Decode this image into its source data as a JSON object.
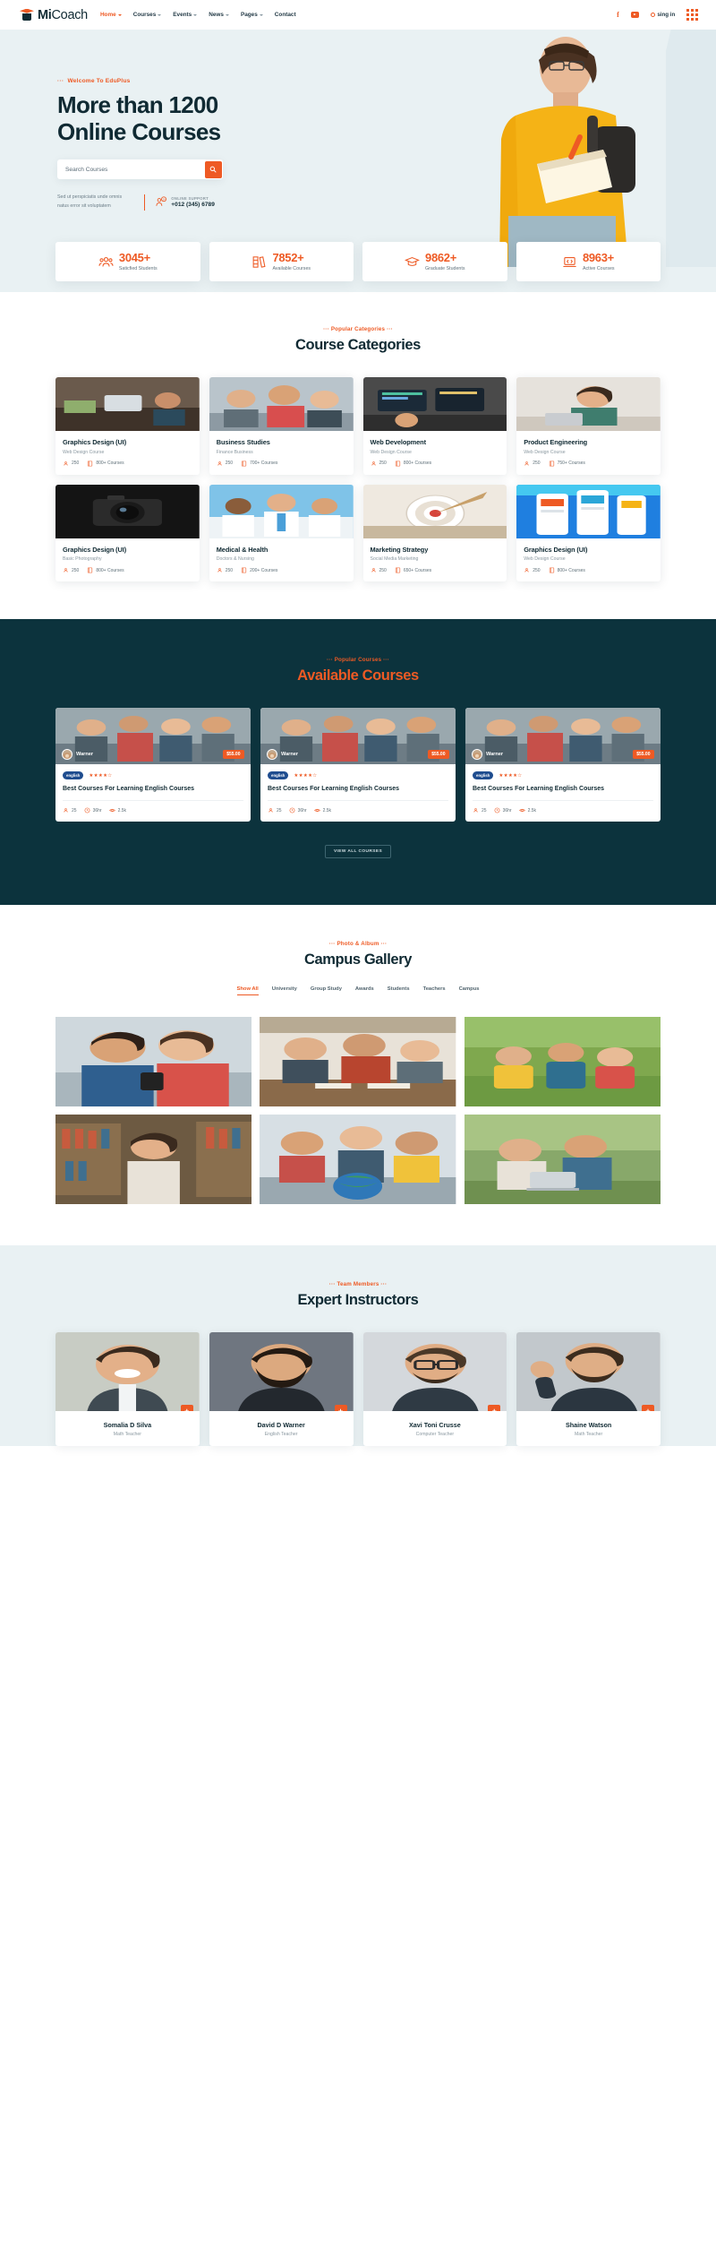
{
  "header": {
    "brand_first": "Mi",
    "brand_second": "Coach",
    "logo_icon": "graduation-cap-icon",
    "nav": [
      {
        "label": "Home",
        "has_caret": true,
        "active": true
      },
      {
        "label": "Courses",
        "has_caret": true,
        "active": false
      },
      {
        "label": "Events",
        "has_caret": true,
        "active": false
      },
      {
        "label": "News",
        "has_caret": true,
        "active": false
      },
      {
        "label": "Pages",
        "has_caret": true,
        "active": false
      },
      {
        "label": "Contact",
        "has_caret": false,
        "active": false
      }
    ],
    "facebook_icon": "facebook-icon",
    "youtube_icon": "youtube-icon",
    "signin_label": "sing in",
    "grid_icon": "grid-menu-icon"
  },
  "hero": {
    "eyebrow": "Welcome To EduPlus",
    "heading_line1": "More than 1200",
    "heading_line2": "Online Courses",
    "search_placeholder": "Search Courses",
    "search_value": "",
    "search_icon": "search-icon",
    "side_text": "Sed ut perspiciatis unde omnis natus error sit voluptatem",
    "support_icon": "headset-support-icon",
    "support_label": "ONLINE SUPPORT",
    "support_phone": "+012 (345) 6789"
  },
  "stats": [
    {
      "icon": "users-group-icon",
      "value": "3045+",
      "label": "Saticfied Students"
    },
    {
      "icon": "books-icon",
      "value": "7852+",
      "label": "Available Courses"
    },
    {
      "icon": "graduation-cap-icon",
      "value": "9862+",
      "label": "Graduate Students"
    },
    {
      "icon": "laptop-code-icon",
      "value": "8963+",
      "label": "Active Courses"
    }
  ],
  "categories": {
    "eyebrow": "Popular Categories",
    "title": "Course Categories",
    "items": [
      {
        "title": "Graphics Design (UI)",
        "sub": "Web Design Course",
        "students": "250",
        "courses": "800+ Courses",
        "thumb": "office-desk-photo"
      },
      {
        "title": "Business Studies",
        "sub": "Finance Business",
        "students": "250",
        "courses": "700+ Courses",
        "thumb": "team-meeting-photo"
      },
      {
        "title": "Web Development",
        "sub": "Web Design Course",
        "students": "250",
        "courses": "800+ Courses",
        "thumb": "developer-desk-photo"
      },
      {
        "title": "Product Engineering",
        "sub": "Web Design Course",
        "students": "250",
        "courses": "750+ Courses",
        "thumb": "woman-laptop-photo"
      },
      {
        "title": "Graphics Design (UI)",
        "sub": "Basic Photography",
        "students": "250",
        "courses": "800+ Courses",
        "thumb": "camera-photo"
      },
      {
        "title": "Medical & Health",
        "sub": "Doctors & Nursing",
        "students": "250",
        "courses": "200+ Courses",
        "thumb": "doctors-photo"
      },
      {
        "title": "Marketing Strategy",
        "sub": "Social Media Marketing",
        "students": "250",
        "courses": "650+ Courses",
        "thumb": "dartboard-photo"
      },
      {
        "title": "Graphics Design (UI)",
        "sub": "Web Design Course",
        "students": "250",
        "courses": "800+ Courses",
        "thumb": "mobile-ui-photo"
      }
    ]
  },
  "available": {
    "eyebrow": "Popular Courses",
    "title": "Available Courses",
    "view_all": "VIEW ALL COURSES",
    "items": [
      {
        "author": "Warner",
        "price": "$55.00",
        "badge": "english",
        "stars": "★★★★☆",
        "title": "Best Courses For Learning English Courses",
        "m1": "25",
        "m2": "36hr",
        "m3": "2.5k",
        "thumb": "students-group-photo"
      },
      {
        "author": "Warner",
        "price": "$55.00",
        "badge": "english",
        "stars": "★★★★☆",
        "title": "Best Courses For Learning English Courses",
        "m1": "25",
        "m2": "36hr",
        "m3": "2.5k",
        "thumb": "students-group-photo"
      },
      {
        "author": "Warner",
        "price": "$55.00",
        "badge": "english",
        "stars": "★★★★☆",
        "title": "Best Courses For Learning English Courses",
        "m1": "25",
        "m2": "36hr",
        "m3": "2.5k",
        "thumb": "students-group-photo"
      }
    ]
  },
  "gallery": {
    "eyebrow": "Photo & Album",
    "title": "Campus Gallery",
    "filters": [
      {
        "label": "Show All",
        "active": true
      },
      {
        "label": "University",
        "active": false
      },
      {
        "label": "Group Study",
        "active": false
      },
      {
        "label": "Awards",
        "active": false
      },
      {
        "label": "Students",
        "active": false
      },
      {
        "label": "Teachers",
        "active": false
      },
      {
        "label": "Campus",
        "active": false
      }
    ],
    "photos": [
      "two-students-phone-photo",
      "library-table-study-photo",
      "students-on-grass-photo",
      "library-shelves-photo",
      "globe-study-group-photo",
      "outdoor-laptop-students-photo"
    ]
  },
  "instructors": {
    "eyebrow": "Team Members",
    "title": "Expert Instructors",
    "plus_icon": "plus-icon",
    "items": [
      {
        "name": "Somalia D Silva",
        "role": "Math Teacher",
        "thumb": "smiling-man-photo"
      },
      {
        "name": "David D Warner",
        "role": "English Teacher",
        "thumb": "bearded-man-photo"
      },
      {
        "name": "Xavi Toni Crusse",
        "role": "Computer Teacher",
        "thumb": "glasses-man-photo"
      },
      {
        "name": "Shaine Watson",
        "role": "Math Teacher",
        "thumb": "waving-man-photo"
      }
    ]
  }
}
